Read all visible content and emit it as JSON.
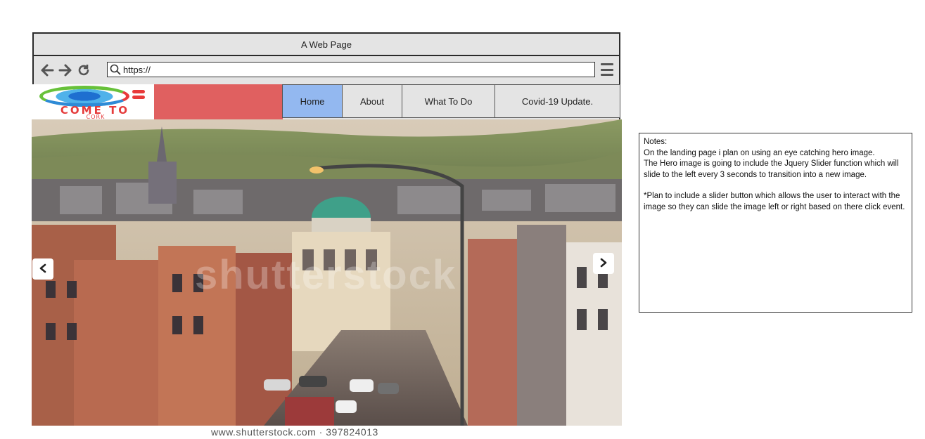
{
  "window": {
    "title": "A Web Page"
  },
  "toolbar": {
    "back_icon": "arrow-left-icon",
    "forward_icon": "arrow-right-icon",
    "reload_icon": "reload-icon",
    "url": "https://",
    "menu_icon": "hamburger-menu-icon"
  },
  "site": {
    "logo_text": "COME TO",
    "logo_subtext": "CORK",
    "logo_colors": {
      "green": "#67c13a",
      "blue": "#2d8ad6",
      "red": "#e83a3a"
    },
    "banner_color": "#e06060",
    "nav": [
      {
        "label": "Home",
        "active": true
      },
      {
        "label": "About",
        "active": false
      },
      {
        "label": "What To Do",
        "active": false
      },
      {
        "label": "Covid-19 Update.",
        "active": false
      }
    ],
    "nav_active_color": "#93b8f0"
  },
  "hero": {
    "watermark": "shutterstock",
    "prev_icon": "chevron-left-icon",
    "next_icon": "chevron-right-icon",
    "caption": "www.shutterstock.com · 397824013"
  },
  "notes": {
    "title": "Notes:",
    "para1": "On the landing page i plan on using an eye catching hero image.",
    "para2": "The Hero image is going to include the Jquery Slider function which will slide to the left every 3 seconds to transition into a new image.",
    "para3": "*Plan to include a slider button which allows the user to interact with the image so they can slide the image left or right based on there click event."
  }
}
